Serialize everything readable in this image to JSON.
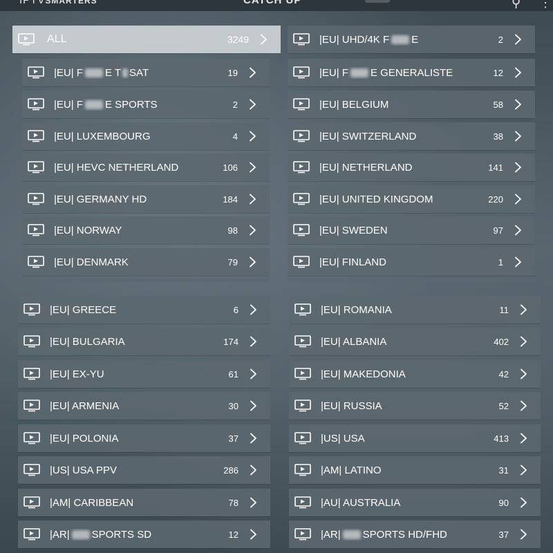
{
  "header": {
    "logo_main": "IPTV",
    "logo_sub": "SMARTERS",
    "title": "CATCH UP"
  },
  "icons": {
    "row_icon": "tv-icon",
    "row_chevron": "chevron-right-icon",
    "search": "search-icon",
    "more": "more-vertical-icon"
  },
  "colors": {
    "row_bg": "#5c6870",
    "active_row_bg": "#cdd2d5"
  },
  "categories": [
    {
      "id": "all",
      "label": "ALL",
      "count": "3249",
      "active": true
    },
    {
      "id": "eu-uhd-4k",
      "label": "|EU| UHD/4K F",
      "label_after": "E",
      "count": "2"
    },
    {
      "id": "eu-france-tnt-sat",
      "label": "|EU| F",
      "label_mid": "E T",
      "label_after": "SAT",
      "count": "19"
    },
    {
      "id": "eu-france-generaliste",
      "label": "|EU| F",
      "label_after": "E GENERALISTE",
      "count": "12"
    },
    {
      "id": "eu-france-sports",
      "label": "|EU| F",
      "label_after": "E SPORTS",
      "count": "2"
    },
    {
      "id": "eu-belgium",
      "label": "|EU| BELGIUM",
      "count": "58"
    },
    {
      "id": "eu-luxembourg",
      "label": "|EU| LUXEMBOURG",
      "count": "4"
    },
    {
      "id": "eu-switzerland",
      "label": "|EU| SWITZERLAND",
      "count": "38"
    },
    {
      "id": "eu-hevc-netherland",
      "label": "|EU| HEVC NETHERLAND",
      "count": "106"
    },
    {
      "id": "eu-netherland",
      "label": "|EU| NETHERLAND",
      "count": "141"
    },
    {
      "id": "eu-germany-hd",
      "label": "|EU| GERMANY HD",
      "count": "184"
    },
    {
      "id": "eu-united-kingdom",
      "label": "|EU| UNITED KINGDOM",
      "count": "220"
    },
    {
      "id": "eu-norway",
      "label": "|EU| NORWAY",
      "count": "98"
    },
    {
      "id": "eu-sweden",
      "label": "|EU| SWEDEN",
      "count": "97"
    },
    {
      "id": "eu-denmark",
      "label": "|EU| DENMARK",
      "count": "79"
    },
    {
      "id": "eu-finland",
      "label": "|EU| FINLAND",
      "count": "1"
    },
    {
      "id": "eu-greece",
      "label": "|EU| GREECE",
      "count": "6"
    },
    {
      "id": "eu-romania",
      "label": "|EU| ROMANIA",
      "count": "11"
    },
    {
      "id": "eu-bulgaria",
      "label": "|EU| BULGARIA",
      "count": "174"
    },
    {
      "id": "eu-albania",
      "label": "|EU| ALBANIA",
      "count": "402"
    },
    {
      "id": "eu-ex-yu",
      "label": "|EU| EX-YU",
      "count": "61"
    },
    {
      "id": "eu-makedonia",
      "label": "|EU| MAKEDONIA",
      "count": "42"
    },
    {
      "id": "eu-armenia",
      "label": "|EU| ARMENIA",
      "count": "30"
    },
    {
      "id": "eu-russia",
      "label": "|EU| RUSSIA",
      "count": "52"
    },
    {
      "id": "eu-polonia",
      "label": "|EU| POLONIA",
      "count": "37"
    },
    {
      "id": "us-usa",
      "label": "|US| USA",
      "count": "413"
    },
    {
      "id": "us-usa-ppv",
      "label": "|US| USA PPV",
      "count": "286"
    },
    {
      "id": "am-latino",
      "label": "|AM| LATINO",
      "count": "31"
    },
    {
      "id": "am-caribbean",
      "label": "|AM| CARIBBEAN",
      "count": "78"
    },
    {
      "id": "au-australia",
      "label": "|AU| AUSTRALIA",
      "count": "90"
    },
    {
      "id": "ar-sports-sd",
      "label": "|AR|",
      "label_after": "SPORTS SD",
      "count": "12"
    },
    {
      "id": "ar-sports-hd-fhd",
      "label": "|AR|",
      "label_after": "SPORTS HD/FHD",
      "count": "37"
    }
  ]
}
